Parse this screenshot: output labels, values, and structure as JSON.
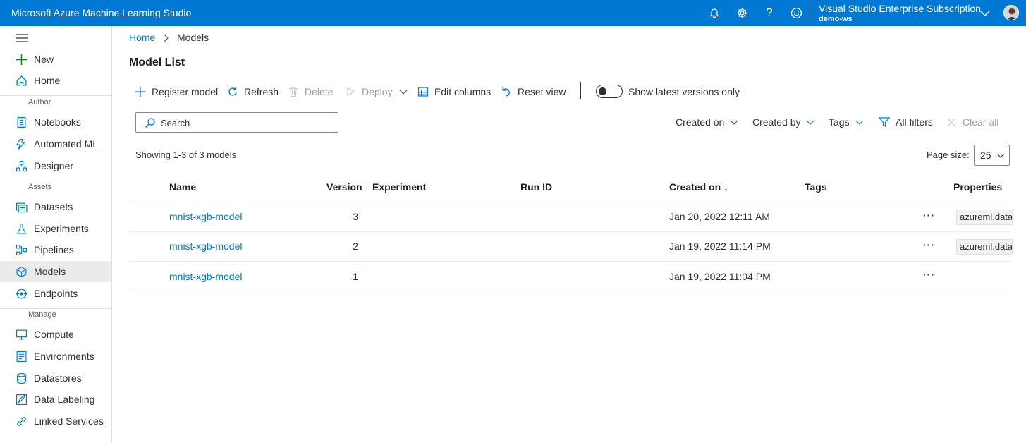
{
  "app": {
    "title": "Microsoft Azure Machine Learning Studio"
  },
  "topbar": {
    "subscription": "Visual Studio Enterprise Subscription",
    "workspace": "demo-ws",
    "icons": [
      "bell-icon",
      "gear-icon",
      "help-icon",
      "smiley-icon",
      "chevron-down-icon"
    ]
  },
  "sidebar": {
    "items": [
      {
        "label": "New",
        "icon": "plus-icon"
      },
      {
        "label": "Home",
        "icon": "home-icon"
      },
      {
        "label": "Notebooks",
        "icon": "notebook-icon"
      },
      {
        "label": "Automated ML",
        "icon": "automl-icon"
      },
      {
        "label": "Designer",
        "icon": "designer-icon"
      },
      {
        "label": "Datasets",
        "icon": "dataset-icon"
      },
      {
        "label": "Experiments",
        "icon": "flask-icon"
      },
      {
        "label": "Pipelines",
        "icon": "pipeline-icon"
      },
      {
        "label": "Models",
        "icon": "cube-icon"
      },
      {
        "label": "Endpoints",
        "icon": "endpoint-icon"
      },
      {
        "label": "Compute",
        "icon": "monitor-icon"
      },
      {
        "label": "Environments",
        "icon": "environment-icon"
      },
      {
        "label": "Datastores",
        "icon": "database-icon"
      },
      {
        "label": "Data Labeling",
        "icon": "labeling-icon"
      },
      {
        "label": "Linked Services",
        "icon": "link-icon"
      }
    ],
    "sections": {
      "author": "Author",
      "assets": "Assets",
      "manage": "Manage"
    },
    "active": "Models"
  },
  "breadcrumb": {
    "home": "Home",
    "current": "Models"
  },
  "page": {
    "title": "Model List"
  },
  "toolbar": {
    "register": "Register model",
    "refresh": "Refresh",
    "delete": "Delete",
    "deploy": "Deploy",
    "edit_columns": "Edit columns",
    "reset_view": "Reset view",
    "toggle_label": "Show latest versions only",
    "toggle_on": false
  },
  "filters": {
    "search_placeholder": "Search",
    "created_on": "Created on",
    "created_by": "Created by",
    "tags": "Tags",
    "all_filters": "All filters",
    "clear_all": "Clear all"
  },
  "summary": {
    "showing": "Showing 1-3 of 3 models",
    "page_size_label": "Page size:",
    "page_size": "25"
  },
  "table": {
    "columns": [
      "Name",
      "Version",
      "Experiment",
      "Run ID",
      "Created on ↓",
      "Tags",
      "Properties"
    ],
    "rows": [
      {
        "name": "mnist-xgb-model",
        "version": "3",
        "experiment": "",
        "run_id": "",
        "created_on": "Jan 20, 2022 12:11 AM",
        "tags": "",
        "properties": "azureml.datas"
      },
      {
        "name": "mnist-xgb-model",
        "version": "2",
        "experiment": "",
        "run_id": "",
        "created_on": "Jan 19, 2022 11:14 PM",
        "tags": "",
        "properties": "azureml.datas"
      },
      {
        "name": "mnist-xgb-model",
        "version": "1",
        "experiment": "",
        "run_id": "",
        "created_on": "Jan 19, 2022 11:04 PM",
        "tags": "",
        "properties": ""
      }
    ],
    "more_label": "···"
  },
  "colors": {
    "brand": "#0078d4",
    "link": "#0078d4",
    "active_nav": "#edebe9"
  }
}
